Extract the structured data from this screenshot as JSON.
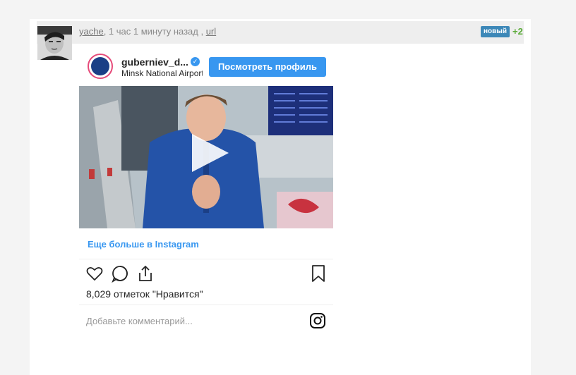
{
  "post": {
    "author": "yache",
    "time": ", 1 час 1 минуту назад ,",
    "link": "url",
    "badge": "новый",
    "score": "+2"
  },
  "instagram": {
    "username": "guberniev_d...",
    "location": "Minsk National Airport",
    "view_profile": "Посмотреть профиль",
    "more": "Еще больше в Instagram",
    "likes": "8,029 отметок \"Нравится\"",
    "comment_placeholder": "Добавьте комментарий..."
  },
  "colors": {
    "accent": "#3897f0",
    "badge": "#3d88b8",
    "score": "#5cab3a"
  },
  "icons": [
    "avatar-photo",
    "verified-icon",
    "play-icon",
    "heart-icon",
    "comment-icon",
    "share-icon",
    "bookmark-icon",
    "instagram-logo-icon"
  ]
}
